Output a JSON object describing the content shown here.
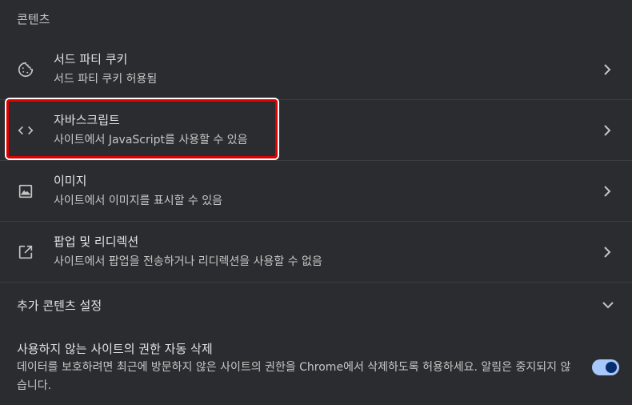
{
  "section": {
    "title": "콘텐츠"
  },
  "rows": [
    {
      "title": "서드 파티 쿠키",
      "subtitle": "서드 파티 쿠키 허용됨",
      "icon": "cookie-icon"
    },
    {
      "title": "자바스크립트",
      "subtitle": "사이트에서 JavaScript를 사용할 수 있음",
      "icon": "code-icon"
    },
    {
      "title": "이미지",
      "subtitle": "사이트에서 이미지를 표시할 수 있음",
      "icon": "image-icon"
    },
    {
      "title": "팝업 및 리디렉션",
      "subtitle": "사이트에서 팝업을 전송하거나 리디렉션을 사용할 수 없음",
      "icon": "open-in-new-icon"
    }
  ],
  "more": {
    "label": "추가 콘텐츠 설정",
    "icon": "chevron-down-icon"
  },
  "auto_delete": {
    "title": "사용하지 않는 사이트의 권한 자동 삭제",
    "description": "데이터를 보호하려면 최근에 방문하지 않은 사이트의 권한을 Chrome에서 삭제하도록 허용하세요. 알림은 중지되지 않습니다.",
    "enabled": true
  },
  "colors": {
    "highlight": "#e00000",
    "toggle_track": "#a8c7fa",
    "toggle_knob": "#062e6f"
  }
}
